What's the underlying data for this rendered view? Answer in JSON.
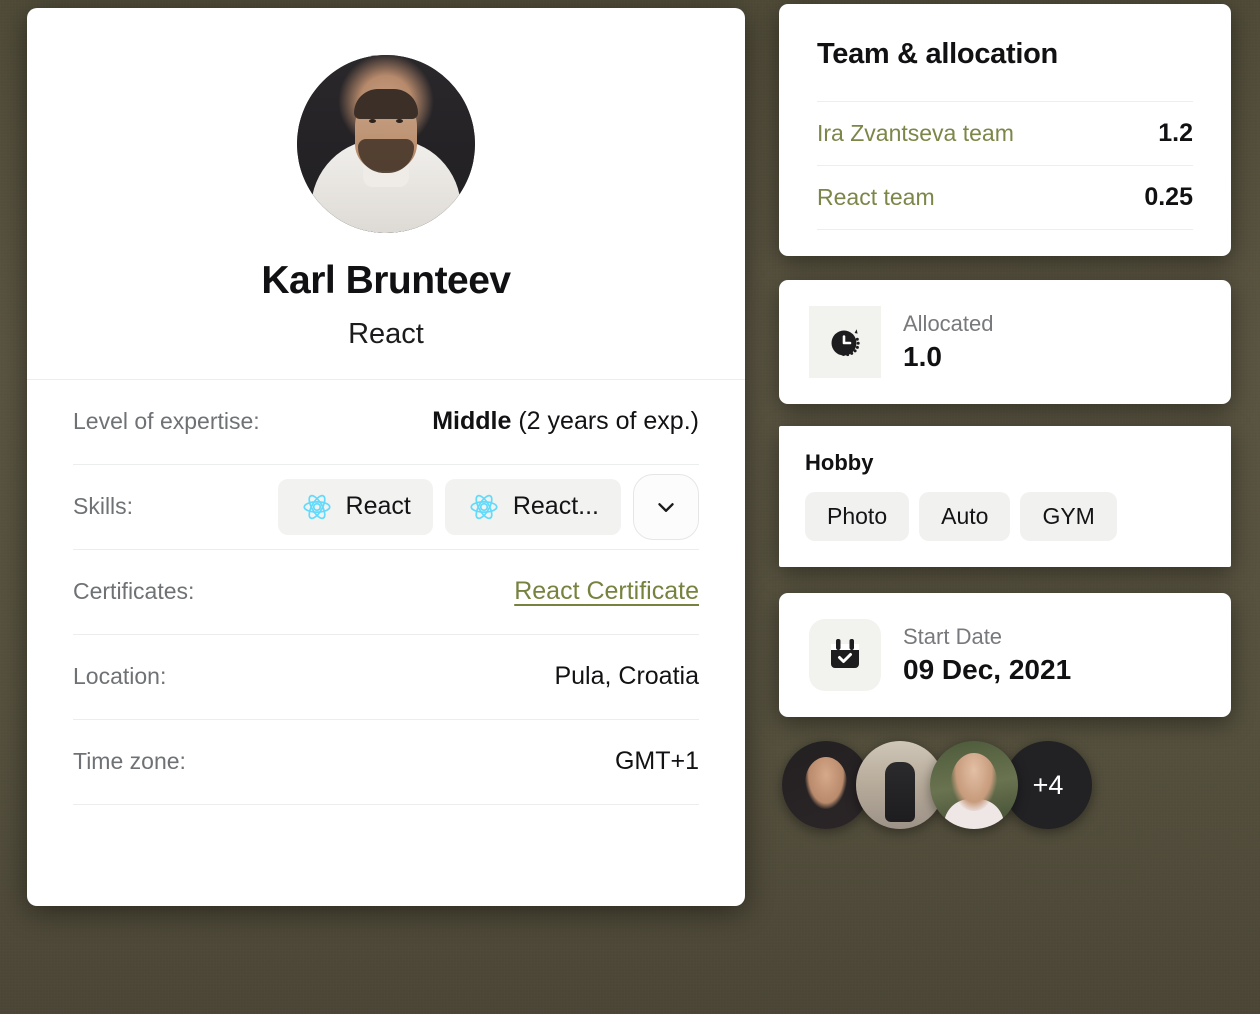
{
  "profile": {
    "avatar_alt": "profile-photo",
    "name": "Karl Brunteev",
    "role": "React",
    "details": [
      {
        "label": "Level of expertise:",
        "value_strong": "Middle",
        "value_rest": "(2 years of exp.)"
      },
      {
        "label": "Skills:",
        "skills": [
          {
            "icon": "react-icon",
            "label": "React"
          },
          {
            "icon": "react-icon",
            "label": "React..."
          }
        ],
        "more_icon": "chevron-down-icon"
      },
      {
        "label": "Certificates:",
        "link": "React Certificate"
      },
      {
        "label": "Location:",
        "value": "Pula, Croatia"
      },
      {
        "label": "Time zone:",
        "value": "GMT+1"
      }
    ]
  },
  "team": {
    "title": "Team & allocation",
    "rows": [
      {
        "name": "Ira Zvantseva team",
        "allocation": "1.2"
      },
      {
        "name": "React team",
        "allocation": "0.25"
      }
    ]
  },
  "allocated": {
    "icon": "clock-timer-icon",
    "label": "Allocated",
    "value": "1.0"
  },
  "hobby": {
    "title": "Hobby",
    "chips": [
      "Photo",
      "Auto",
      "GYM"
    ]
  },
  "start_date": {
    "icon": "calendar-check-icon",
    "label": "Start Date",
    "value": "09 Dec, 2021"
  },
  "members": {
    "avatars": [
      "member-avatar-1",
      "member-avatar-2",
      "member-avatar-3"
    ],
    "more_count": "+4"
  },
  "colors": {
    "accent_olive": "#7c8648",
    "react_blue": "#61dafb",
    "text_primary": "#111113",
    "text_muted": "#6f7275",
    "chip_bg": "#f2f2f0",
    "card_bg": "#ffffff",
    "backdrop": "#55503c",
    "avatar_more_bg": "#222225"
  }
}
